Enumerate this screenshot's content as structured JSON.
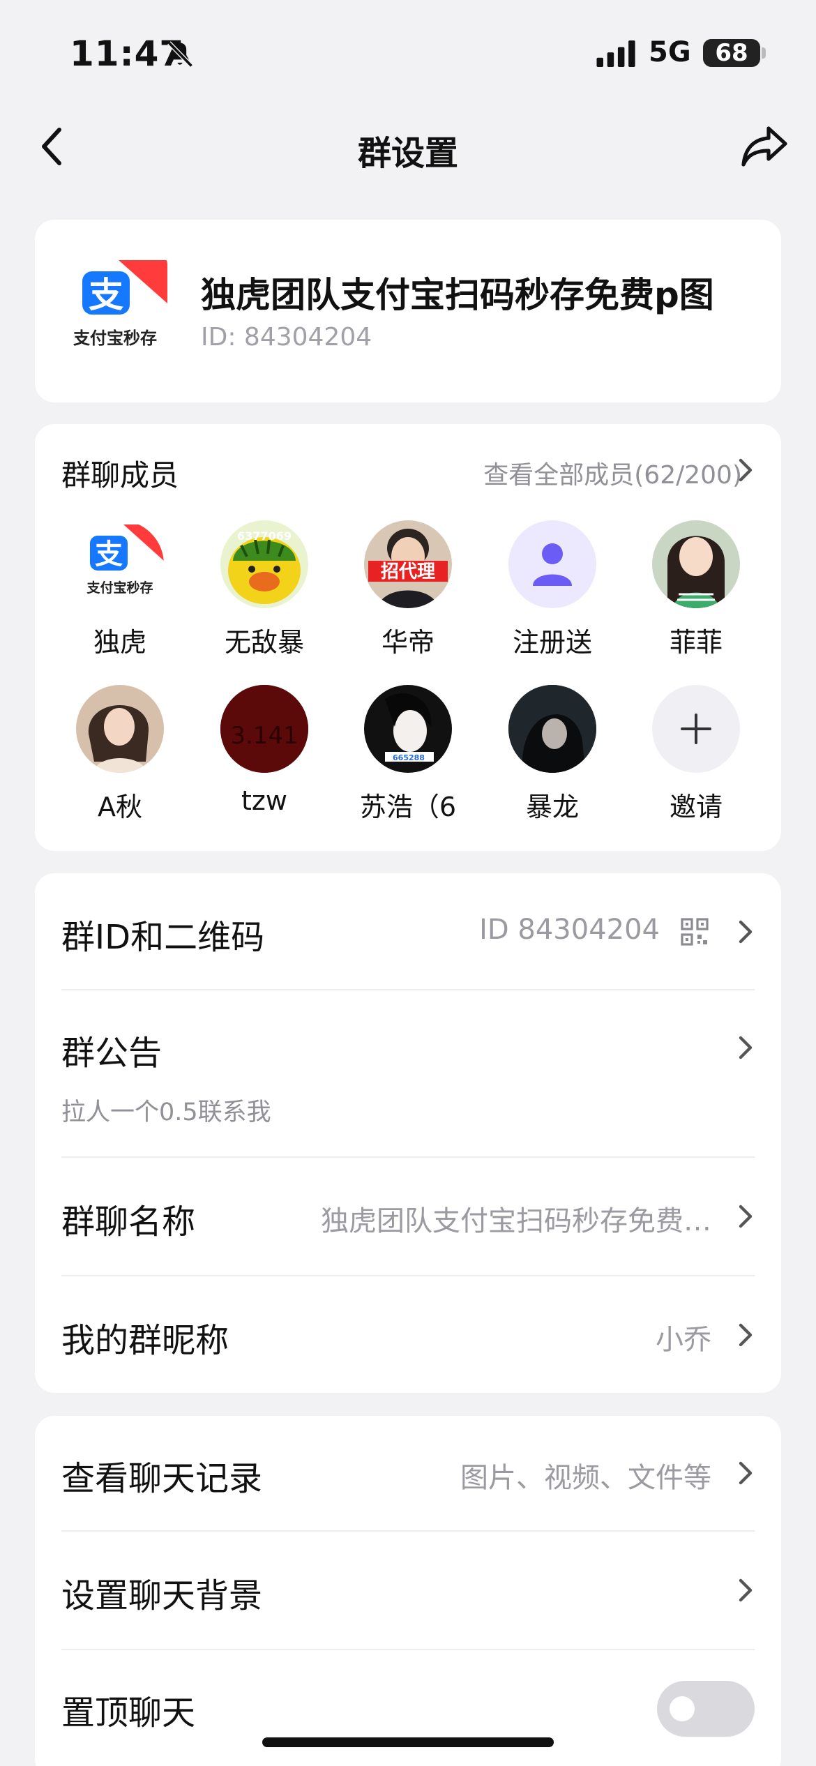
{
  "status_bar": {
    "time": "11:47",
    "network": "5G",
    "battery": "68"
  },
  "nav": {
    "title": "群设置",
    "back_icon": "chevron-left-icon",
    "share_icon": "share-icon"
  },
  "group": {
    "logo_symbol": "支",
    "logo_caption": "支付宝秒存",
    "name": "独虎团队支付宝扫码秒存免费p图",
    "id_text": "ID: 84304204"
  },
  "members": {
    "title": "群聊成员",
    "view_all": "查看全部成员(62/200)",
    "list": [
      {
        "name": "独虎",
        "avatar": "alipay-logo",
        "caption": "支付宝秒存"
      },
      {
        "name": "无敌暴",
        "avatar": "yellow-mascot",
        "caption": "6377069"
      },
      {
        "name": "华帝",
        "avatar": "photo-man",
        "caption": "招代理"
      },
      {
        "name": "注册送",
        "avatar": "default-user"
      },
      {
        "name": "菲菲",
        "avatar": "photo-woman-green"
      },
      {
        "name": "A秋",
        "avatar": "photo-woman"
      },
      {
        "name": "tzw",
        "avatar": "dark-red",
        "caption": "3.141"
      },
      {
        "name": "苏浩（6",
        "avatar": "anime-girl",
        "caption": "665288"
      },
      {
        "name": "暴龙",
        "avatar": "photo-dark-woman"
      },
      {
        "name": "邀请",
        "avatar": "plus"
      }
    ]
  },
  "settings": {
    "group_qr": {
      "label": "群ID和二维码",
      "value": "ID 84304204"
    },
    "announcement": {
      "label": "群公告",
      "sub": "拉人一个0.5联系我"
    },
    "group_name": {
      "label": "群聊名称",
      "value": "独虎团队支付宝扫码秒存免费…"
    },
    "nickname": {
      "label": "我的群昵称",
      "value": "小乔"
    },
    "history": {
      "label": "查看聊天记录",
      "value": "图片、视频、文件等"
    },
    "background": {
      "label": "设置聊天背景"
    },
    "pin": {
      "label": "置顶聊天",
      "on": false
    }
  },
  "colors": {
    "accent": "#6b5cf6",
    "alipay_blue": "#1677ff",
    "background": "#f2f2f4"
  }
}
